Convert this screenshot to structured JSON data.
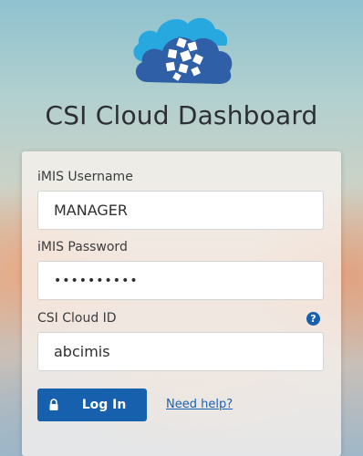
{
  "app": {
    "title": "CSI Cloud Dashboard",
    "logo_icon": "csi-cloud-cubes-logo"
  },
  "form": {
    "username": {
      "label": "iMIS Username",
      "value": "MANAGER"
    },
    "password": {
      "label": "iMIS Password",
      "masked_value": "••••••••••"
    },
    "cloud_id": {
      "label": "CSI Cloud ID",
      "value": "abcimis",
      "help_icon": "question-circle-icon"
    },
    "login_button": {
      "label": "Log In",
      "icon": "lock-icon"
    },
    "help_link": "Need help?"
  },
  "colors": {
    "primary": "#1760ad",
    "cloud_dark": "#2f5fa6",
    "cloud_light": "#27a8df",
    "link": "#1a63b0"
  }
}
